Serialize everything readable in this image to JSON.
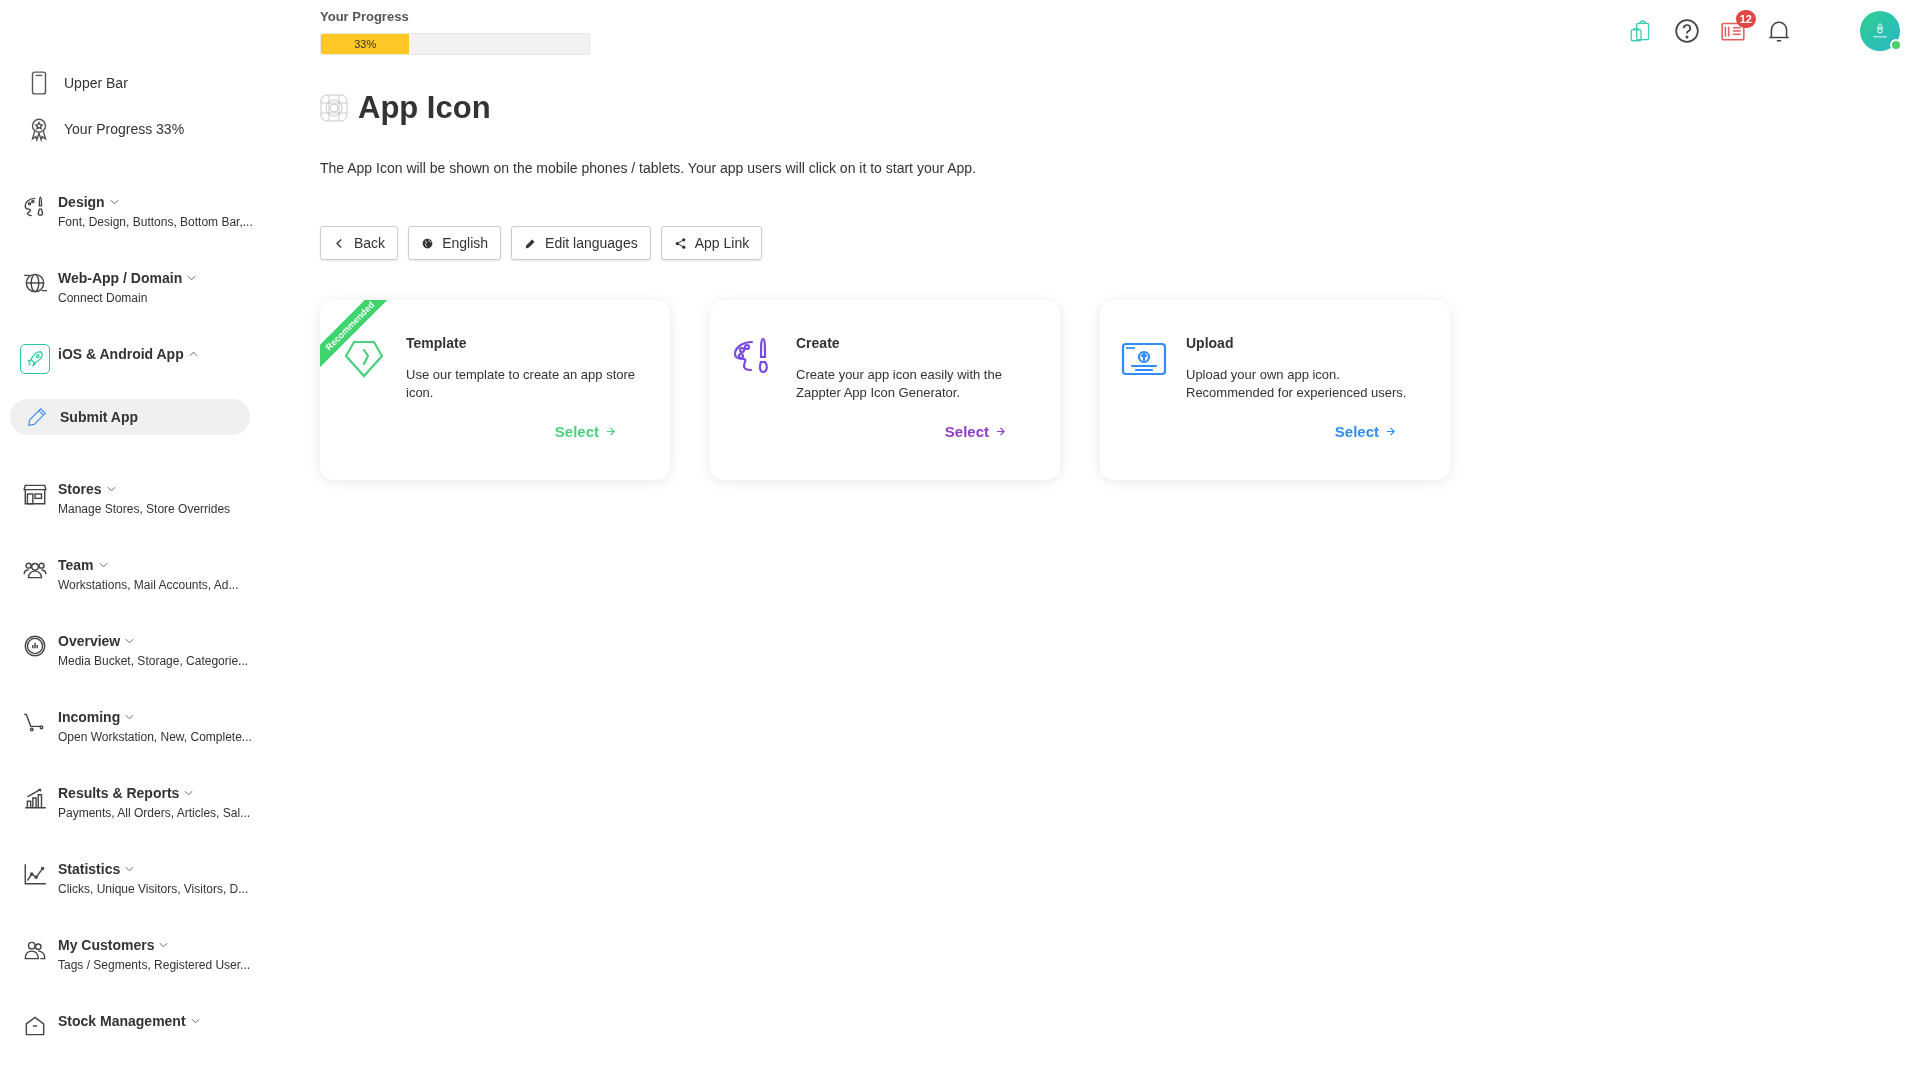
{
  "sidebar": {
    "items": [
      {
        "kind": "link",
        "title": "Upper Bar"
      },
      {
        "kind": "link",
        "title": "Your Progress 33%"
      },
      {
        "kind": "group",
        "title": "Design",
        "subtitle": "Font, Design, Buttons, Bottom Bar,...",
        "expanded": false
      },
      {
        "kind": "group",
        "title": "Web-App / Domain",
        "subtitle": "Connect Domain",
        "expanded": false
      },
      {
        "kind": "group",
        "title": "iOS & Android App",
        "expanded": true
      },
      {
        "kind": "subitem",
        "title": "Submit App",
        "selected": true
      },
      {
        "kind": "group",
        "title": "Stores",
        "subtitle": "Manage Stores, Store Overrides",
        "expanded": false
      },
      {
        "kind": "group",
        "title": "Team",
        "subtitle": "Workstations, Mail Accounts, Ad...",
        "expanded": false
      },
      {
        "kind": "group",
        "title": "Overview",
        "subtitle": "Media Bucket, Storage, Categorie...",
        "expanded": false
      },
      {
        "kind": "group",
        "title": "Incoming",
        "subtitle": "Open Workstation, New, Complete...",
        "expanded": false
      },
      {
        "kind": "group",
        "title": "Results & Reports",
        "subtitle": "Payments, All Orders, Articles, Sal...",
        "expanded": false
      },
      {
        "kind": "group",
        "title": "Statistics",
        "subtitle": "Clicks, Unique Visitors, Visitors, D...",
        "expanded": false
      },
      {
        "kind": "group",
        "title": "My Customers",
        "subtitle": "Tags / Segments, Registered User...",
        "expanded": false
      },
      {
        "kind": "group",
        "title": "Stock Management",
        "expanded": false
      }
    ]
  },
  "progress": {
    "label": "Your Progress",
    "level": 0.33,
    "reading": "33%"
  },
  "header": {
    "notification_count": "12"
  },
  "page": {
    "title": "App Icon",
    "description": "The App Icon will be shown on the mobile phones / tablets. Your app users will click on it to start your App."
  },
  "toolbar": [
    {
      "kind": "back",
      "label": "Back"
    },
    {
      "kind": "globe",
      "label": "English"
    },
    {
      "kind": "edit",
      "label": "Edit languages"
    },
    {
      "kind": "share",
      "label": "App Link"
    }
  ],
  "cards": [
    {
      "kind": "template",
      "title": "Template",
      "description": "Use our template to create an app store icon.",
      "action": "Select",
      "color": "#4cd07d",
      "ribbon": "Recommended"
    },
    {
      "kind": "create",
      "title": "Create",
      "description": "Create your app icon easily with the Zappter App Icon Generator.",
      "action": "Select",
      "color": "#8e3fc9"
    },
    {
      "kind": "upload",
      "title": "Upload",
      "description": "Upload your own app icon. Recommended for experienced users.",
      "action": "Select",
      "color": "#2f8df5"
    }
  ]
}
